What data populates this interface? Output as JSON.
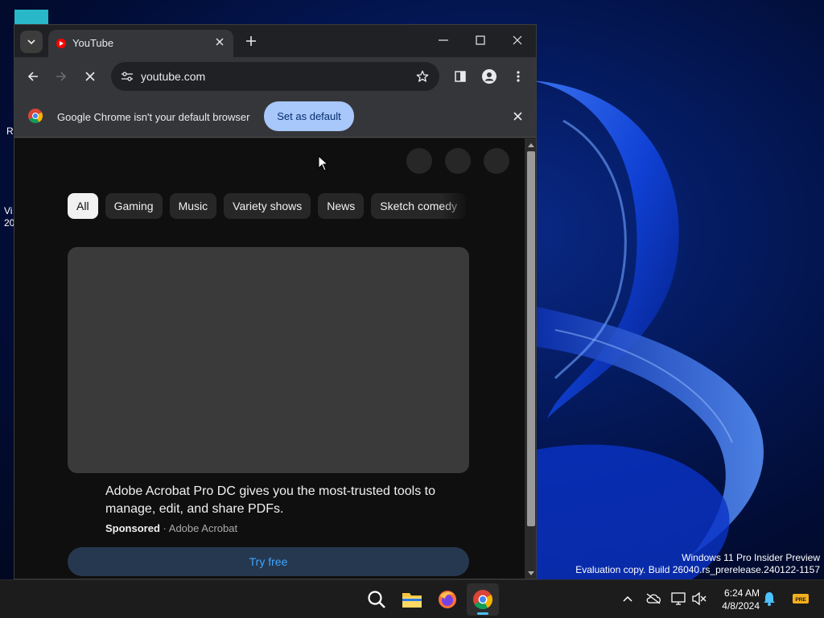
{
  "desktop": {
    "icon_stub_1": "Re",
    "icon_stub_2a": "Vi",
    "icon_stub_2b": "20",
    "watermark_line1": "Windows 11 Pro Insider Preview",
    "watermark_line2": "Evaluation copy. Build 26040.rs_prerelease.240122-1157"
  },
  "browser": {
    "tab_title": "YouTube",
    "url": "youtube.com",
    "infobar": {
      "message": "Google Chrome isn't your default browser",
      "button_label": "Set as default"
    }
  },
  "youtube": {
    "chips": [
      {
        "label": "All",
        "active": true
      },
      {
        "label": "Gaming",
        "active": false
      },
      {
        "label": "Music",
        "active": false
      },
      {
        "label": "Variety shows",
        "active": false
      },
      {
        "label": "News",
        "active": false
      },
      {
        "label": "Sketch comedy",
        "active": false
      }
    ],
    "ad": {
      "title": "Adobe Acrobat Pro DC gives you the most-trusted tools to manage, edit, and share PDFs.",
      "sponsored_label": "Sponsored",
      "separator": "·",
      "advertiser": "Adobe Acrobat",
      "cta_label": "Try free"
    }
  },
  "taskbar": {
    "apps": [
      "search-icon",
      "file-explorer-icon",
      "firefox-icon",
      "chrome-icon"
    ],
    "active_app": "chrome-icon",
    "time": "6:24 AM",
    "date": "4/8/2024",
    "tray_badge": "PRE"
  },
  "colors": {
    "chrome_dark": "#202124",
    "chrome_toolbar": "#35363a",
    "infobar_button": "#a8c7fa",
    "youtube_bg": "#0f0f0f",
    "youtube_red": "#ff0000",
    "link_blue": "#3ea6ff",
    "taskbar": "#1c1c1c"
  }
}
